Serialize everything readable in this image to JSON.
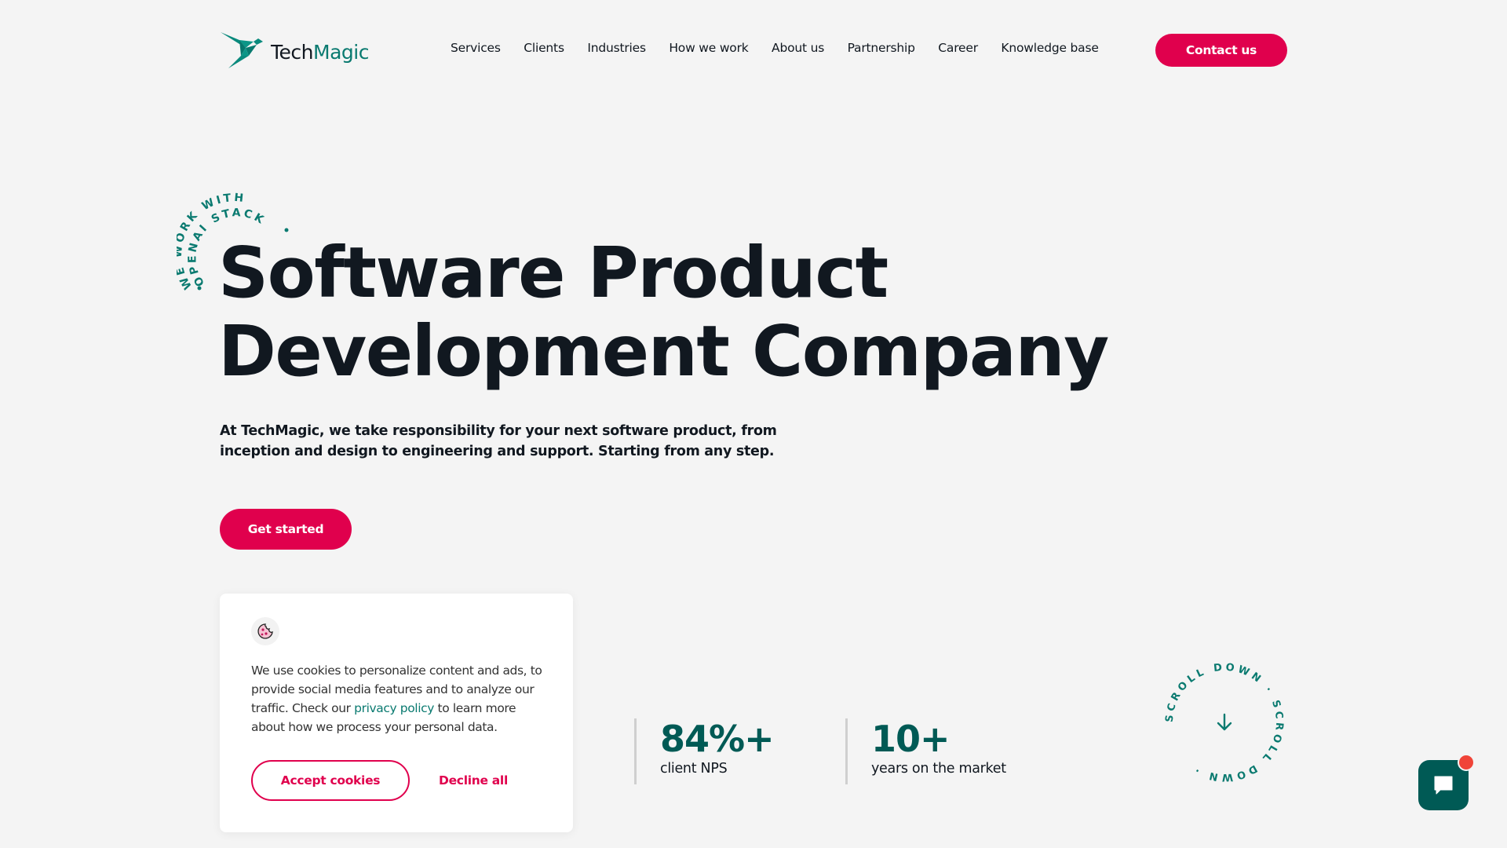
{
  "brand": {
    "name_part1": "Tech",
    "name_part2": "Magic",
    "primary_color": "#e0004d",
    "accent_color": "#0a7a70",
    "dark_accent": "#005a55"
  },
  "nav": {
    "items": [
      {
        "label": "Services"
      },
      {
        "label": "Clients"
      },
      {
        "label": "Industries"
      },
      {
        "label": "How we work"
      },
      {
        "label": "About us"
      },
      {
        "label": "Partnership"
      },
      {
        "label": "Career"
      },
      {
        "label": "Knowledge base"
      }
    ],
    "contact_label": "Contact us"
  },
  "hero": {
    "badge_text": "WE WORK WITH OPENAI STACK",
    "badge_line1": "WE WORK WITH",
    "badge_line2": "OPENAI STACK",
    "title_line1": "Software Product",
    "title_line2": "Development Company",
    "subtitle": "At TechMagic, we take responsibility for your next software product, from inception and design to engineering and support. Starting from any step.",
    "cta_label": "Get started"
  },
  "cookie_banner": {
    "icon": "cookie-icon",
    "text_before": "We use cookies to personalize content and ads, to provide social media features and to analyze our traffic. Check our ",
    "link_text": "privacy policy",
    "text_after": " to learn more about how we process your personal data.",
    "accept_label": "Accept cookies",
    "decline_label": "Decline all"
  },
  "stats": [
    {
      "value": "84%+",
      "label": "client NPS"
    },
    {
      "value": "10+",
      "label": "years on the market"
    }
  ],
  "scroll_indicator": {
    "text": "SCROLL DOWN · SCROLL DOWN · ",
    "icon": "arrow-down-icon"
  },
  "chat": {
    "icon": "chat-bubble-icon",
    "has_notification": true
  }
}
